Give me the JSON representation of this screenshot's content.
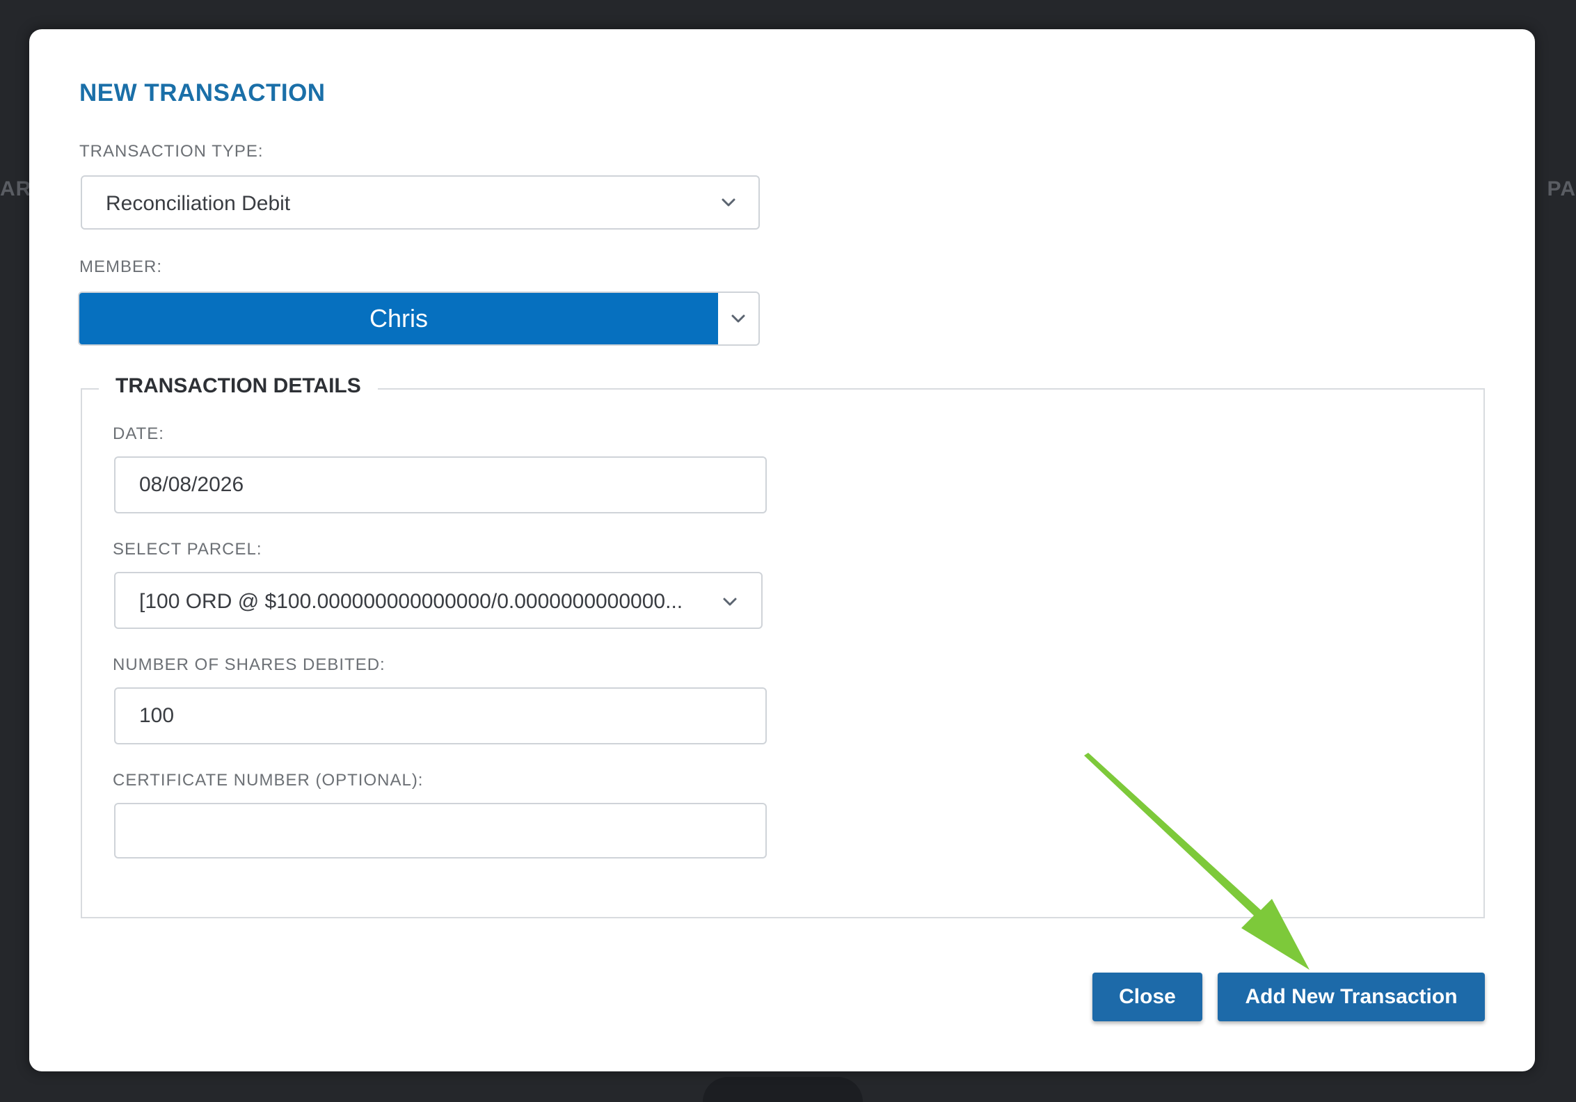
{
  "backdrop": {
    "left_fragment": "ARE",
    "right_fragment": "PA"
  },
  "modal": {
    "title": "NEW TRANSACTION",
    "transaction_type": {
      "label": "TRANSACTION TYPE:",
      "selected": "Reconciliation Debit"
    },
    "member": {
      "label": "MEMBER:",
      "selected": "Chris"
    },
    "details": {
      "legend": "TRANSACTION DETAILS",
      "date": {
        "label": "DATE:",
        "value": "08/08/2026"
      },
      "parcel": {
        "label": "SELECT PARCEL:",
        "selected": "[100 ORD @ $100.000000000000000/0.0000000000000..."
      },
      "shares_debited": {
        "label": "NUMBER OF SHARES DEBITED:",
        "value": "100"
      },
      "certificate_number": {
        "label": "CERTIFICATE NUMBER (OPTIONAL):",
        "value": ""
      }
    },
    "buttons": {
      "close": "Close",
      "add": "Add New Transaction"
    }
  },
  "colors": {
    "title": "#1a6fa8",
    "member_selected_bg": "#0670bf",
    "button_bg": "#1d6aa9",
    "annotation_arrow": "#7dc93a"
  },
  "icons": {
    "dropdown": "chevron-down-icon",
    "annotation": "arrow-annotation-icon"
  }
}
